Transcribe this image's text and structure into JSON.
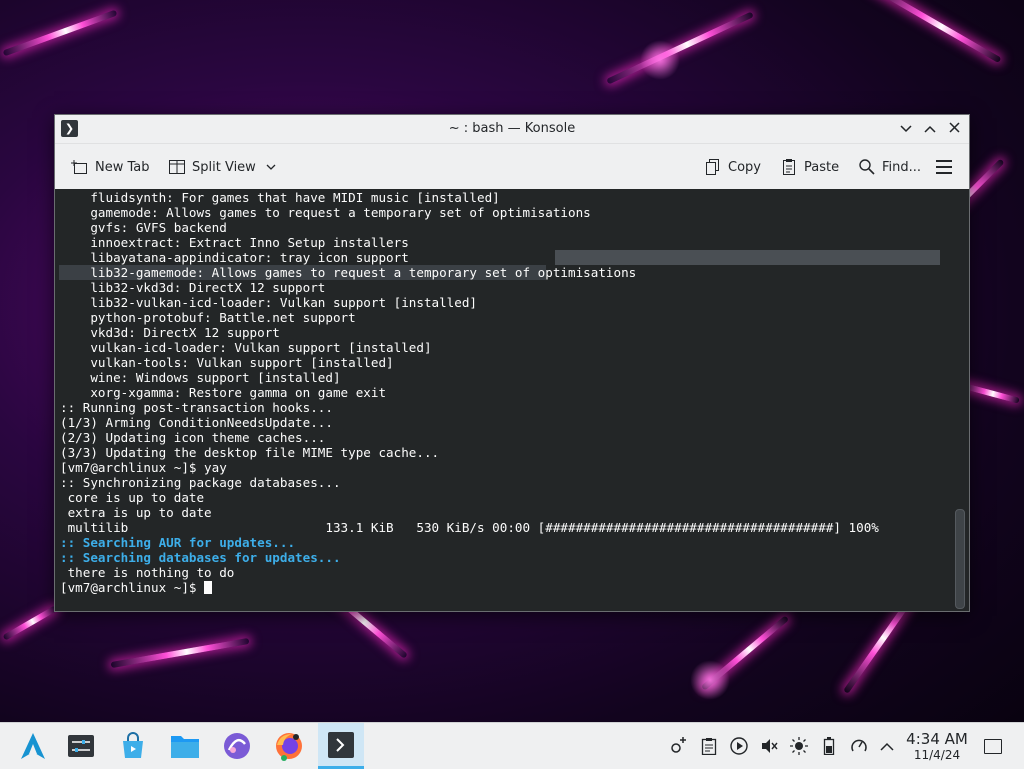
{
  "window": {
    "title": "~ : bash — Konsole",
    "toolbar": {
      "new_tab": "New Tab",
      "split_view": "Split View",
      "copy": "Copy",
      "paste": "Paste",
      "find": "Find..."
    }
  },
  "terminal": {
    "lines": [
      "    fluidsynth: For games that have MIDI music [installed]",
      "    gamemode: Allows games to request a temporary set of optimisations",
      "    gvfs: GVFS backend",
      "    innoextract: Extract Inno Setup installers",
      "    libayatana-appindicator: tray icon support",
      "    lib32-gamemode: Allows games to request a temporary set of optimisations",
      "    lib32-vkd3d: DirectX 12 support",
      "    lib32-vulkan-icd-loader: Vulkan support [installed]",
      "    python-protobuf: Battle.net support",
      "    vkd3d: DirectX 12 support",
      "    vulkan-icd-loader: Vulkan support [installed]",
      "    vulkan-tools: Vulkan support [installed]",
      "    wine: Windows support [installed]",
      "    xorg-xgamma: Restore gamma on game exit",
      ":: Running post-transaction hooks...",
      "(1/3) Arming ConditionNeedsUpdate...",
      "(2/3) Updating icon theme caches...",
      "(3/3) Updating the desktop file MIME type cache...",
      "[vm7@archlinux ~]$ yay",
      ":: Synchronizing package databases...",
      " core is up to date",
      " extra is up to date",
      " multilib                          133.1 KiB   530 KiB/s 00:00 [######################################] 100%",
      ":: Searching AUR for updates...",
      ":: Searching databases for updates...",
      " there is nothing to do"
    ],
    "prompt": "[vm7@archlinux ~]$ "
  },
  "taskbar": {
    "apps": [
      {
        "name": "application-launcher-icon"
      },
      {
        "name": "system-settings-icon"
      },
      {
        "name": "discover-icon"
      },
      {
        "name": "file-manager-icon"
      },
      {
        "name": "app-icon"
      },
      {
        "name": "firefox-icon"
      },
      {
        "name": "konsole-icon"
      }
    ],
    "time": "4:34 AM",
    "date": "11/4/24"
  },
  "colors": {
    "accent": "#3daee9",
    "terminal_bg": "#232627",
    "terminal_fg": "#fcfcfc"
  }
}
